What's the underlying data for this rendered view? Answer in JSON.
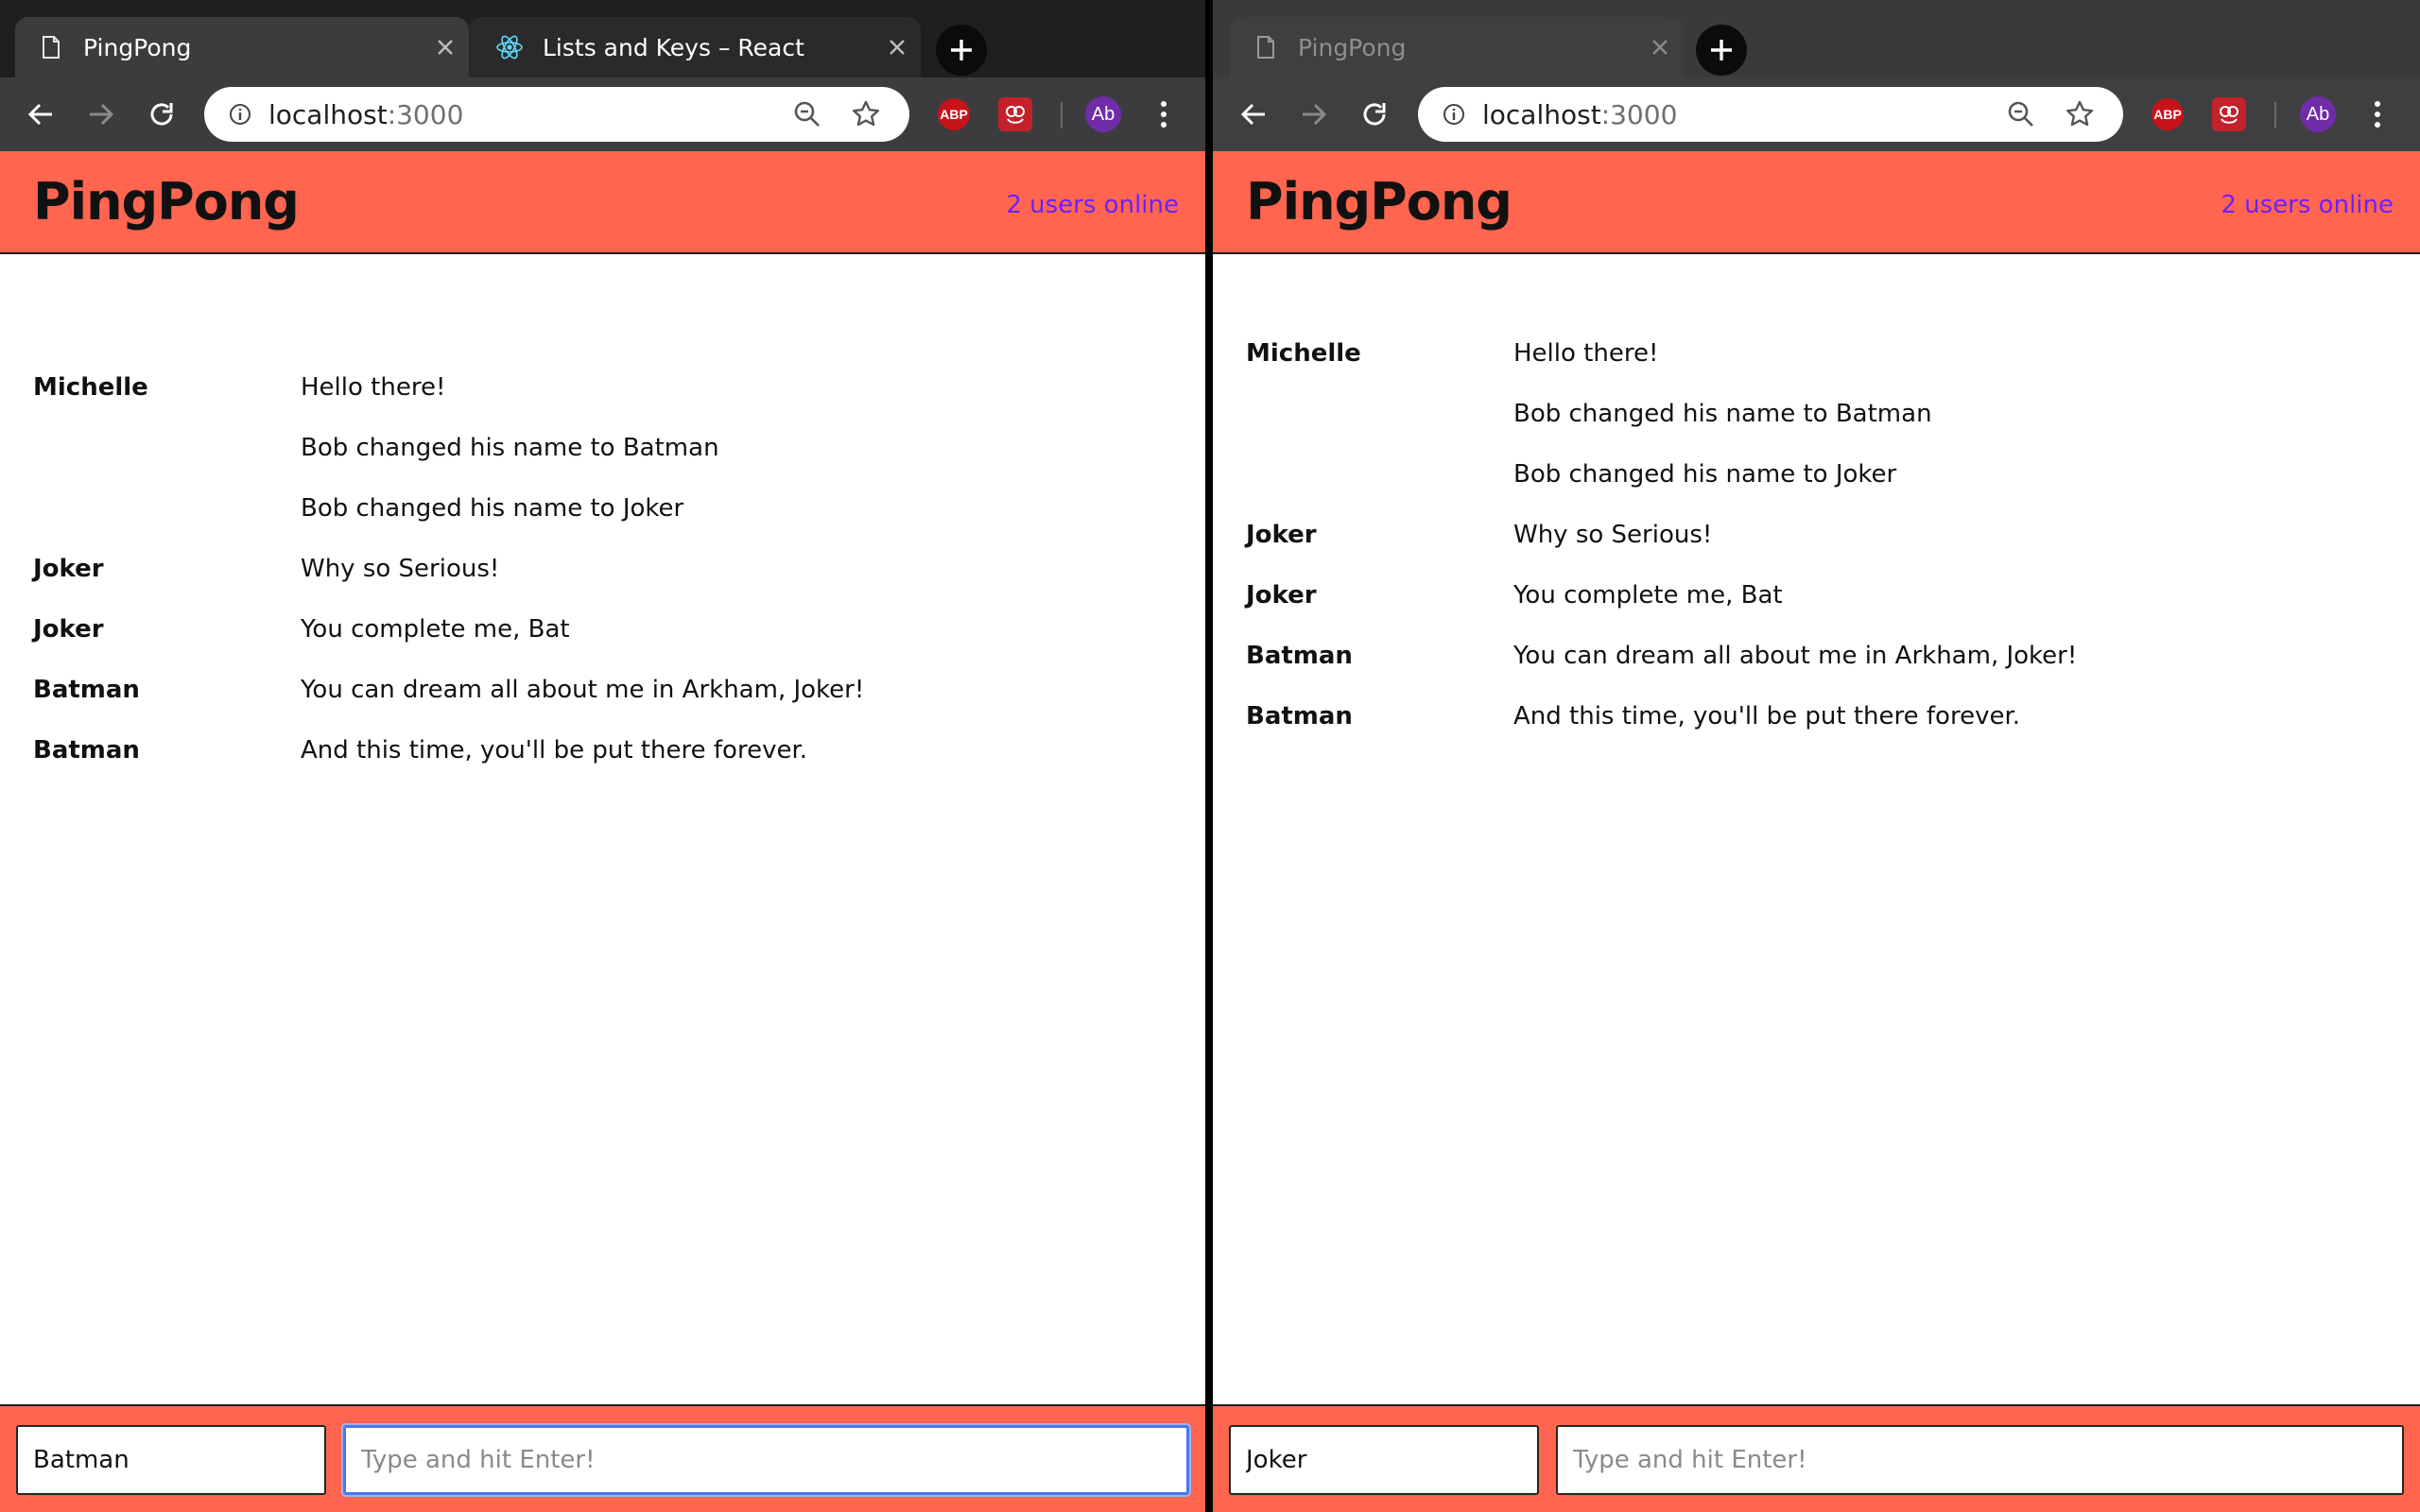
{
  "browser": {
    "url_host": "localhost",
    "url_port": ":3000",
    "extensions": {
      "abp_label": "ABP",
      "profile_initials": "Ab"
    }
  },
  "left": {
    "tabs": [
      {
        "title": "PingPong",
        "icon": "document-icon",
        "active": true
      },
      {
        "title": "Lists and Keys – React",
        "icon": "react-icon",
        "active": false
      }
    ],
    "app": {
      "title": "PingPong",
      "online_status": "2 users online",
      "messages": [
        {
          "author": "Michelle",
          "text": "Hello there!"
        },
        {
          "author": "",
          "text": "Bob changed his name to Batman"
        },
        {
          "author": "",
          "text": "Bob changed his name to Joker"
        },
        {
          "author": "Joker",
          "text": "Why so Serious!"
        },
        {
          "author": "Joker",
          "text": "You complete me, Bat"
        },
        {
          "author": "Batman",
          "text": "You can dream all about me in Arkham, Joker!"
        },
        {
          "author": "Batman",
          "text": "And this time, you'll be put there forever."
        }
      ],
      "name_value": "Batman",
      "message_placeholder": "Type and hit Enter!"
    }
  },
  "right": {
    "tabs": [
      {
        "title": "PingPong",
        "icon": "document-icon",
        "active": true
      }
    ],
    "app": {
      "title": "PingPong",
      "online_status": "2 users online",
      "messages": [
        {
          "author": "Michelle",
          "text": "Hello there!"
        },
        {
          "author": "",
          "text": "Bob changed his name to Batman"
        },
        {
          "author": "",
          "text": "Bob changed his name to Joker"
        },
        {
          "author": "Joker",
          "text": "Why so Serious!"
        },
        {
          "author": "Joker",
          "text": "You complete me, Bat"
        },
        {
          "author": "Batman",
          "text": "You can dream all about me in Arkham, Joker!"
        },
        {
          "author": "Batman",
          "text": "And this time, you'll be put there forever."
        }
      ],
      "name_value": "Joker",
      "message_placeholder": "Type and hit Enter!"
    }
  },
  "colors": {
    "app_accent": "#ff654f",
    "online_text": "#6e1fff",
    "focus_ring": "#4f76e8"
  }
}
